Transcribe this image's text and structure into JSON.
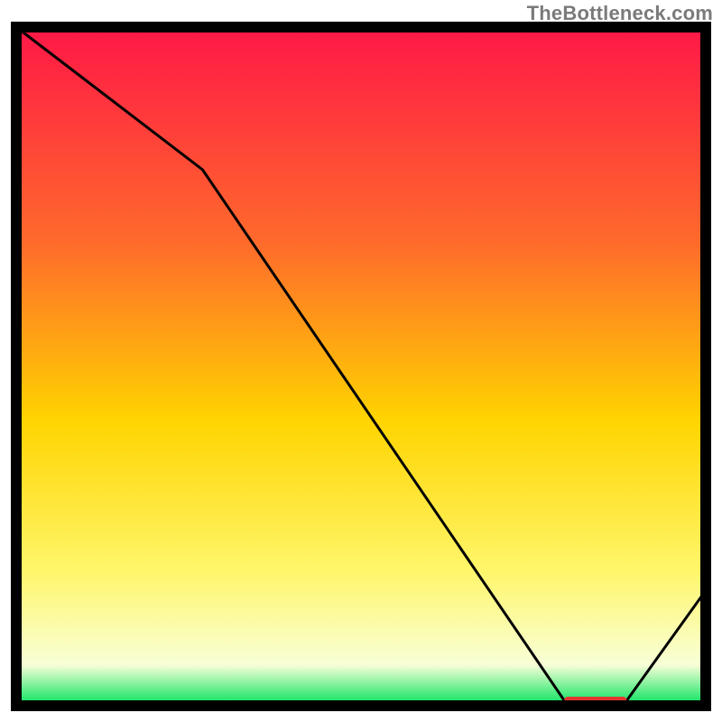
{
  "watermark": "TheBottleneck.com",
  "chart_data": {
    "type": "line",
    "title": "",
    "xlabel": "",
    "ylabel": "",
    "xlim": [
      0,
      100
    ],
    "ylim": [
      0,
      100
    ],
    "x": [
      0,
      27,
      80,
      88,
      100
    ],
    "values": [
      100,
      79,
      0,
      0,
      17
    ],
    "flat_region_x": [
      80,
      88
    ],
    "background_gradient": {
      "top": "#ff1747",
      "upper_mid": "#ff6b2b",
      "mid": "#ffd400",
      "lower_mid": "#fff66a",
      "near_bottom": "#f8ffd7",
      "bottom": "#00e25a"
    }
  }
}
